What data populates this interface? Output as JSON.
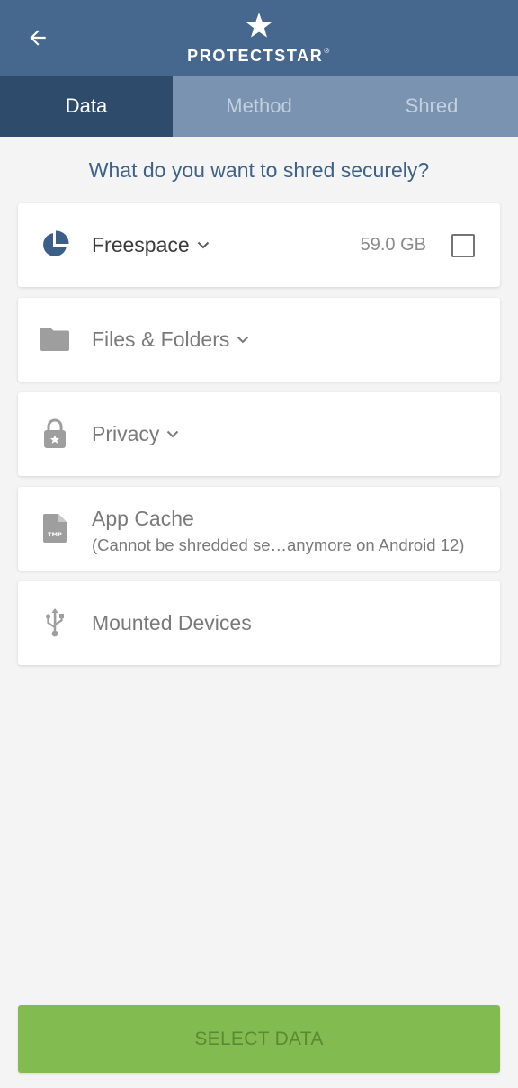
{
  "header": {
    "brand": "PROTECTSTAR",
    "brand_mark": "®",
    "back_icon": "arrow-left-icon",
    "logo_icon": "star-icon",
    "color": "#46688f"
  },
  "tabs": [
    {
      "label": "Data",
      "active": true
    },
    {
      "label": "Method",
      "active": false
    },
    {
      "label": "Shred",
      "active": false
    }
  ],
  "question": "What do you want to shred securely?",
  "items": [
    {
      "label": "Freespace",
      "size": "59.0 GB",
      "icon": "pie-chart-icon",
      "checked": false
    },
    {
      "label": "Files & Folders",
      "icon": "folder-icon"
    },
    {
      "label": "Privacy",
      "icon": "lock-icon"
    },
    {
      "label": "App Cache",
      "sublabel": "(Cannot be shredded se…anymore on Android 12)",
      "icon": "tmp-file-icon"
    },
    {
      "label": "Mounted Devices",
      "icon": "usb-icon"
    }
  ],
  "action": {
    "label": "SELECT DATA",
    "color": "#82bc50"
  }
}
